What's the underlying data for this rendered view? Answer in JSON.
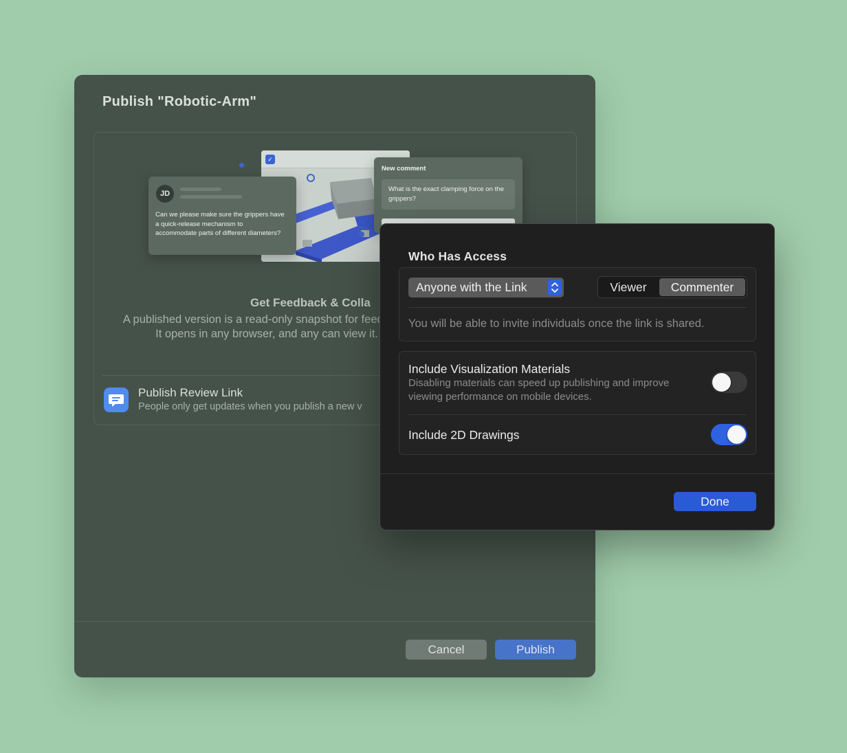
{
  "dialog": {
    "title": "Publish  \"Robotic-Arm\"",
    "illustration": {
      "avatar_initials": "JD",
      "left_comment": "Can we please make sure the grippers have a quick-release mechanism to accommodate parts of different diameters?",
      "new_comment_header": "New comment",
      "new_comment_text": "What is the exact clamping force on the grippers?"
    },
    "feature_title": "Get Feedback & Colla",
    "feature_description": "A published version is a read-only snapshot for feedback. It opens in any browser, and any can view it.",
    "review_link": {
      "title": "Publish Review Link",
      "subtitle": "People only get updates when you publish a new v",
      "icon": "speech-bubble-icon"
    },
    "cancel_label": "Cancel",
    "publish_label": "Publish"
  },
  "access_sheet": {
    "title": "Who Has Access",
    "link_scope": "Anyone with the Link",
    "roles": [
      "Viewer",
      "Commenter"
    ],
    "selected_role": "Commenter",
    "invite_note": "You will be able to invite individuals once the link is shared.",
    "options": [
      {
        "title": "Include Visualization Materials",
        "description": "Disabling materials can speed up publishing and improve viewing performance on mobile devices.",
        "enabled": false
      },
      {
        "title": "Include 2D Drawings",
        "description": "",
        "enabled": true
      }
    ],
    "done_label": "Done"
  },
  "colors": {
    "background": "#a0ccab",
    "dialog_bg": "#45524a",
    "sheet_bg": "#1f1f1f",
    "accent_blue": "#2f62e0"
  }
}
